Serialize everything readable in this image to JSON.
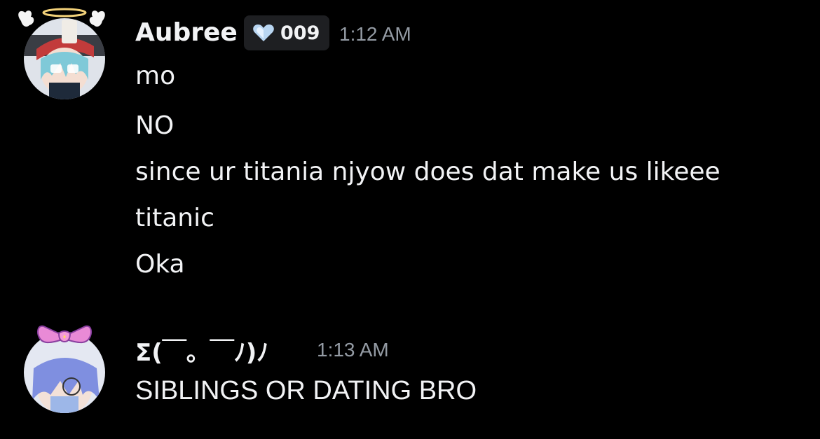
{
  "messages": [
    {
      "username": "Aubree",
      "tag": {
        "icon": "heart-gem-icon",
        "label": "009"
      },
      "timestamp": "1:12 AM",
      "lines": [
        "mo",
        "NO",
        "since ur titania njyow does dat make us likeee",
        "titanic",
        "Oka"
      ],
      "avatar": {
        "name": "angel-avatar",
        "accent": "#d94f4f",
        "hair": "#7fc9d8"
      }
    },
    {
      "username": "Σ(￣。￣ﾉ)ﾉ",
      "timestamp": "1:13 AM",
      "lines": [
        "SIBLINGS OR DATING BRO"
      ],
      "avatar": {
        "name": "bow-avatar",
        "accent": "#e98ad6",
        "hair": "#7f8fe0"
      }
    }
  ],
  "colors": {
    "background": "#000000",
    "text": "#f2f3f5",
    "muted": "#949ba4",
    "tag_bg": "#1e1f22"
  }
}
